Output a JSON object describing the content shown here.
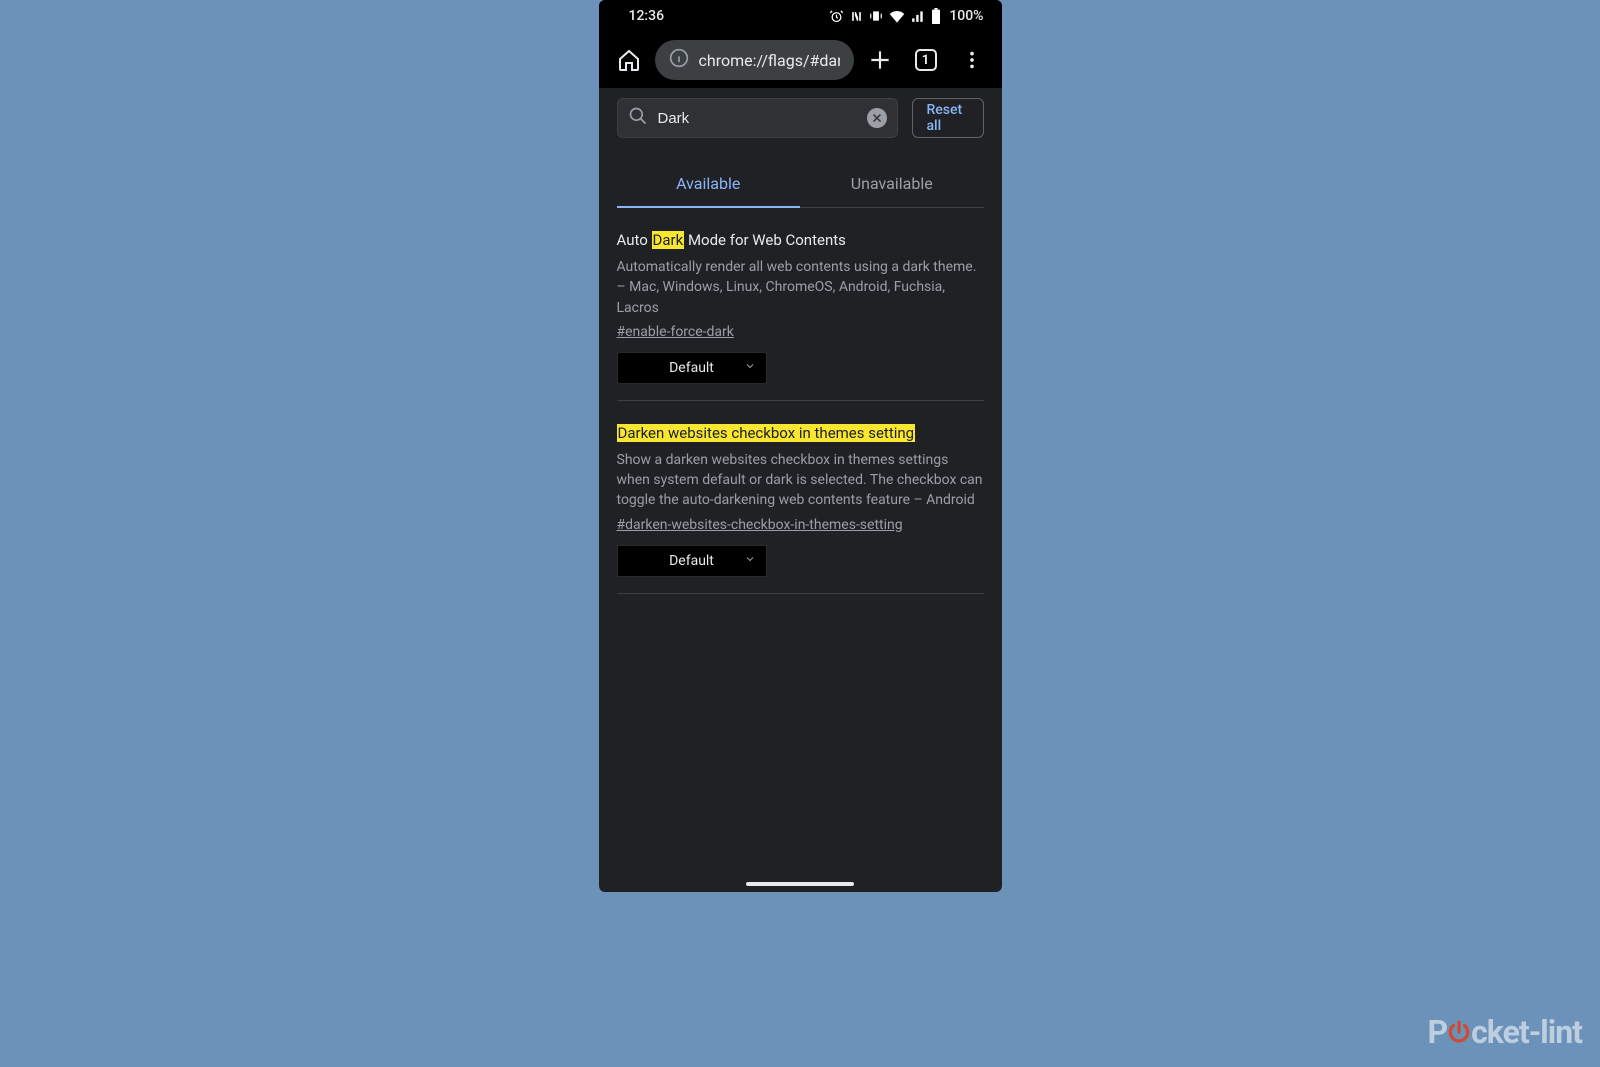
{
  "status_bar": {
    "time": "12:36",
    "battery_pct": "100%"
  },
  "toolbar": {
    "url": "chrome://flags/#darken-",
    "tab_count": "1"
  },
  "search": {
    "value": "Dark",
    "reset_label": "Reset all"
  },
  "tabs": {
    "available": "Available",
    "unavailable": "Unavailable"
  },
  "flags": [
    {
      "title_pre": "Auto ",
      "title_hl": "Dark",
      "title_post": " Mode for Web Contents",
      "full_highlight": false,
      "desc": "Automatically render all web contents using a dark theme. – Mac, Windows, Linux, ChromeOS, Android, Fuchsia, Lacros",
      "anchor": "#enable-force-dark",
      "dropdown_value": "Default"
    },
    {
      "title_pre": "",
      "title_hl": "Darken websites checkbox in themes setting",
      "title_post": "",
      "full_highlight": true,
      "desc": "Show a darken websites checkbox in themes settings when system default or dark is selected. The checkbox can toggle the auto-darkening web contents feature – Android",
      "anchor": "#darken-websites-checkbox-in-themes-setting",
      "dropdown_value": "Default"
    }
  ],
  "watermark": {
    "left": "P",
    "right": "cket-lint"
  }
}
